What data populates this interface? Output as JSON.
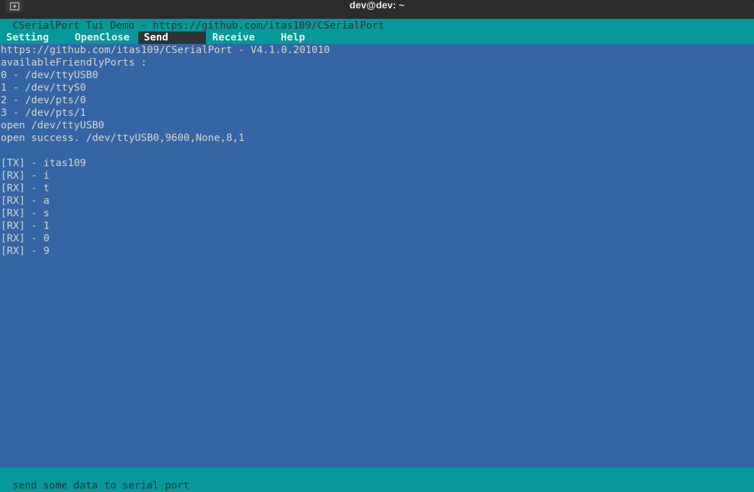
{
  "window": {
    "title": "dev@dev: ~"
  },
  "app": {
    "title": "CSerialPort Tui Demo - https://github.com/itas109/CSerialPort",
    "menu": [
      "Setting",
      "OpenClose",
      "Send",
      "Receive",
      "Help"
    ],
    "active_menu": "Send"
  },
  "output": {
    "lines": [
      "https://github.com/itas109/CSerialPort - V4.1.0.201010",
      "availableFriendlyPorts :",
      "0 - /dev/ttyUSB0",
      "1 - /dev/ttyS0",
      "2 - /dev/pts/0",
      "3 - /dev/pts/1",
      "open /dev/ttyUSB0",
      "open success. /dev/ttyUSB0,9600,None,8,1",
      "",
      "[TX] - itas109",
      "[RX] - i",
      "[RX] - t",
      "[RX] - a",
      "[RX] - s",
      "[RX] - 1",
      "[RX] - 0",
      "[RX] - 9"
    ]
  },
  "status": {
    "text": "send some data to serial port"
  },
  "colors": {
    "terminal_bg": "#3465a4",
    "bar_bg": "#06989a",
    "text_light": "#d3d7cf",
    "active_menu_bg": "#2e3436"
  },
  "icons": {
    "new_tab": "new-tab-icon"
  }
}
